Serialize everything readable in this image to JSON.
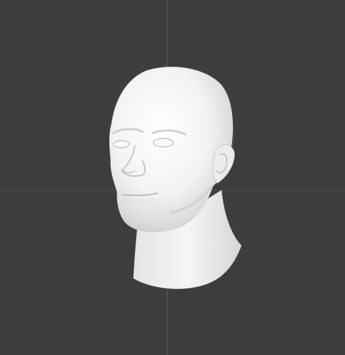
{
  "viewport": {
    "background_color": "#3d3d3d",
    "grid_line_color": "#505050",
    "axis_line_color": "#3f6b63",
    "model": {
      "name": "head-bust",
      "material_color": "#f2f2f2",
      "shadow_color": "#bdbdbd"
    }
  }
}
